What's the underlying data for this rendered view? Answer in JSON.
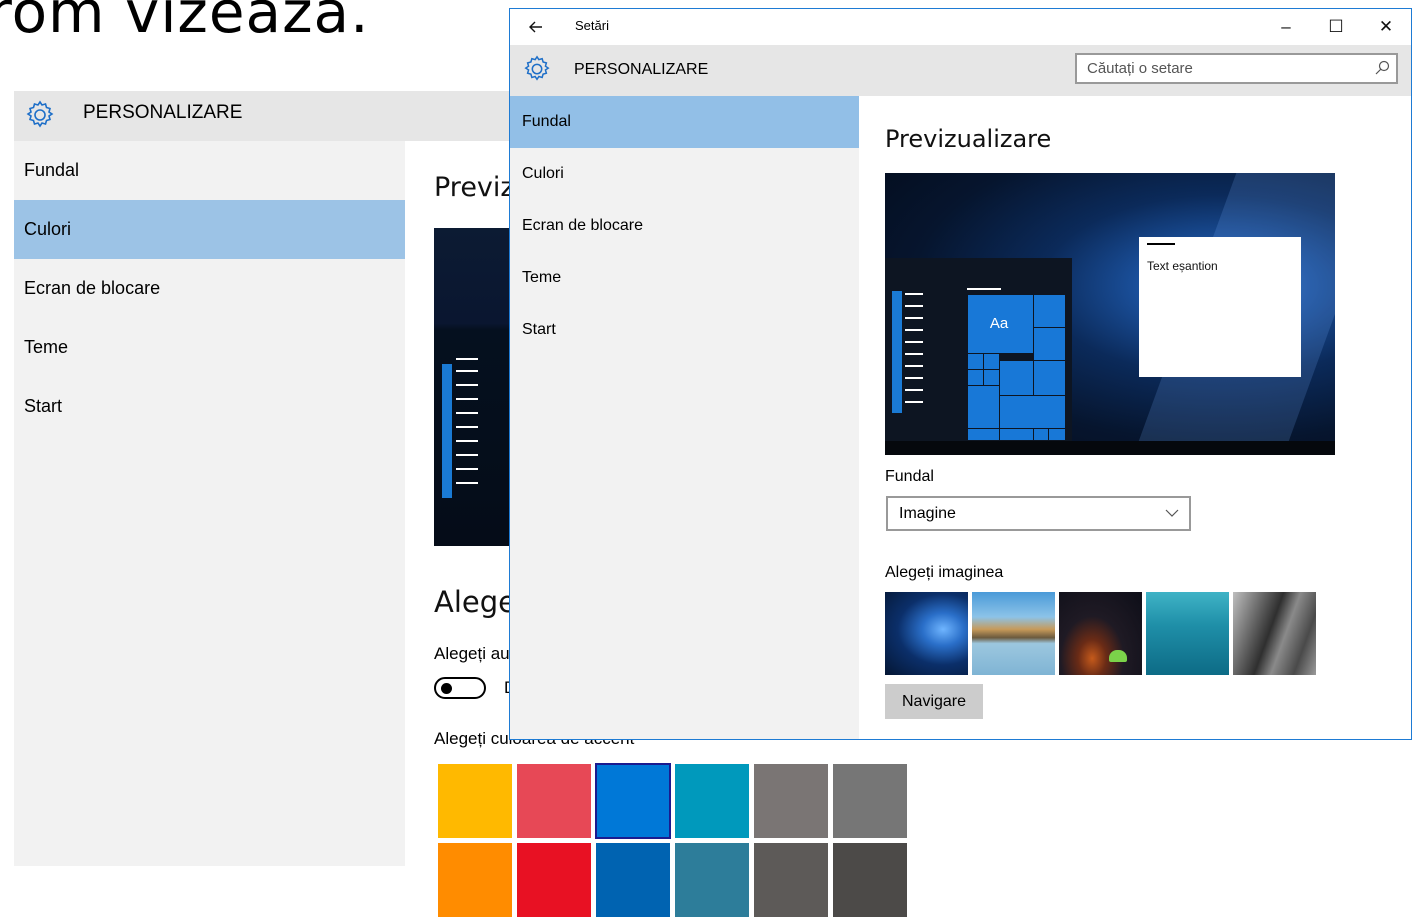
{
  "background_window": {
    "caption": "rom vizează.",
    "header_title": "PERSONALIZARE",
    "nav": [
      "Fundal",
      "Culori",
      "Ecran de blocare",
      "Teme",
      "Start"
    ],
    "selected_nav": "Culori",
    "preview_title": "Previz",
    "choose_title": "Alege",
    "choose_auto_label": "Alegeți au",
    "toggle_label": "D",
    "accent_label": "Alegeți culoarea de accent",
    "accent_colors_row1": [
      "#ffb900",
      "#e74856",
      "#0078d7",
      "#0099bc",
      "#7a7574",
      "#767676"
    ],
    "accent_colors_row2": [
      "#ff8c00",
      "#e81123",
      "#0063b1",
      "#2d7d9a",
      "#5d5a58",
      "#4c4a48"
    ],
    "selected_accent": "#0078d7"
  },
  "window": {
    "title": "Setări",
    "back_icon": "back-arrow-icon",
    "controls": {
      "minimize": "–",
      "maximize": "☐",
      "close": "✕"
    },
    "header_title": "PERSONALIZARE",
    "search_placeholder": "Căutați o setare",
    "nav": [
      {
        "label": "Fundal",
        "selected": true
      },
      {
        "label": "Culori",
        "selected": false
      },
      {
        "label": "Ecran de blocare",
        "selected": false
      },
      {
        "label": "Teme",
        "selected": false
      },
      {
        "label": "Start",
        "selected": false
      }
    ],
    "preview_title": "Previzualizare",
    "preview": {
      "tile_label": "Aa",
      "sample_text": "Text eșantion"
    },
    "background_label": "Fundal",
    "background_value": "Imagine",
    "choose_image_label": "Alegeți imaginea",
    "image_thumbnails": [
      "windows-hero",
      "beach-rocks",
      "night-sky-tent",
      "underwater-swimmer",
      "rock-cliff"
    ],
    "browse_button": "Navigare",
    "accent_color": "#1878d7",
    "selection_color": "#92bfe7"
  }
}
